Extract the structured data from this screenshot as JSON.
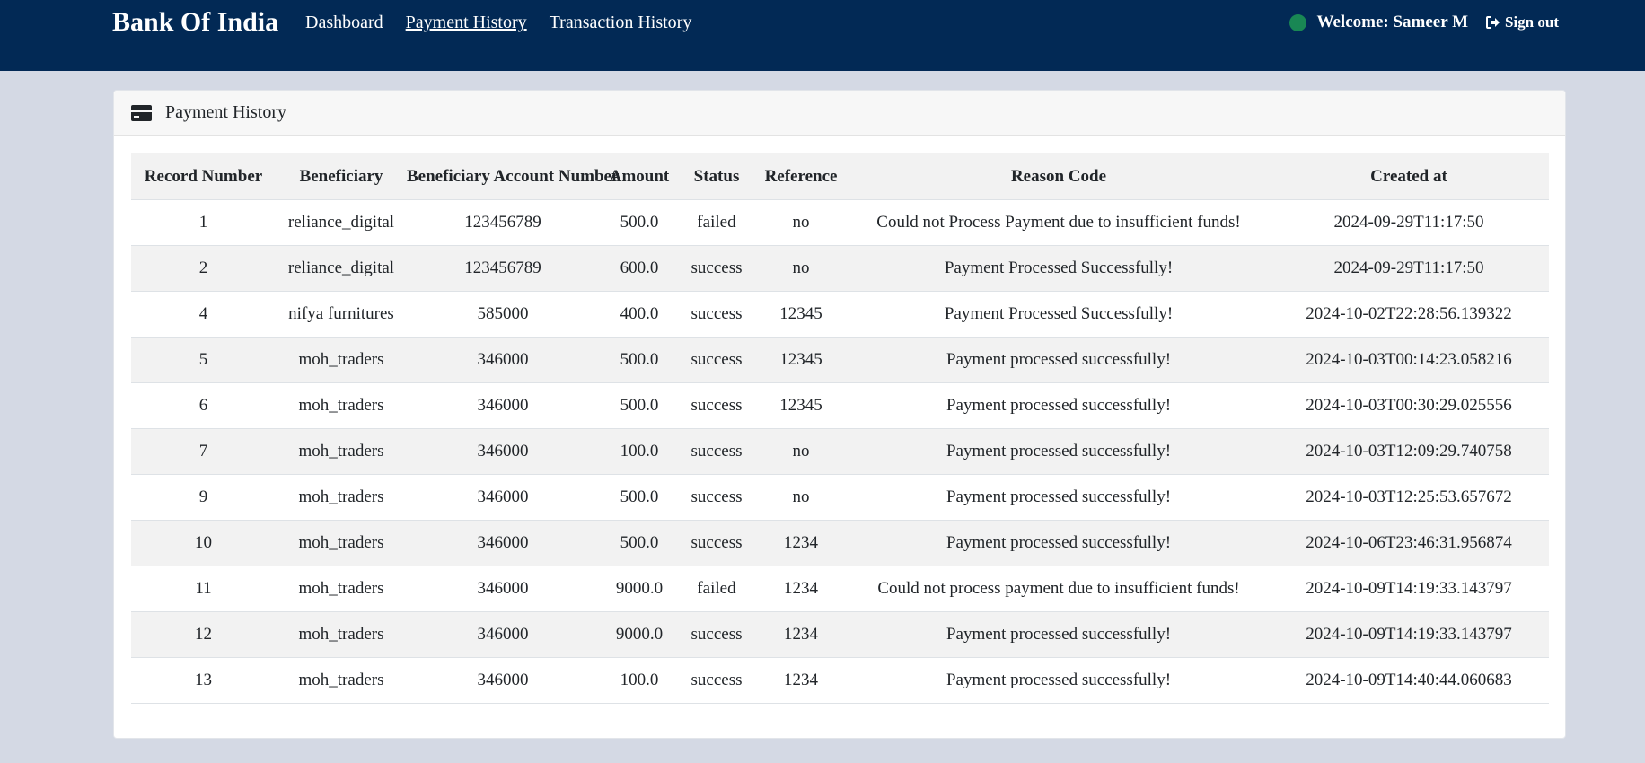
{
  "app": {
    "brand": "Bank Of India"
  },
  "nav": {
    "items": [
      {
        "label": "Dashboard",
        "active": false
      },
      {
        "label": "Payment History",
        "active": true
      },
      {
        "label": "Transaction History",
        "active": false
      }
    ],
    "welcome": "Welcome: Sameer M",
    "signout": "Sign out"
  },
  "colors": {
    "navbar": "#022955",
    "status_dot": "#198754",
    "page_bg": "#d4d9e4"
  },
  "icons": {
    "card_header": "credit-card-icon",
    "signout": "sign-out-icon",
    "status": "online-status-dot"
  },
  "card": {
    "title": "Payment History"
  },
  "table": {
    "headers": [
      "Record Number",
      "Beneficiary",
      "Beneficiary Account Number",
      "Amount",
      "Status",
      "Reference",
      "Reason Code",
      "Created at"
    ],
    "rows": [
      [
        "1",
        "reliance_digital",
        "123456789",
        "500.0",
        "failed",
        "no",
        "Could not Process Payment due to insufficient funds!",
        "2024-09-29T11:17:50"
      ],
      [
        "2",
        "reliance_digital",
        "123456789",
        "600.0",
        "success",
        "no",
        "Payment Processed Successfully!",
        "2024-09-29T11:17:50"
      ],
      [
        "4",
        "nifya furnitures",
        "585000",
        "400.0",
        "success",
        "12345",
        "Payment Processed Successfully!",
        "2024-10-02T22:28:56.139322"
      ],
      [
        "5",
        "moh_traders",
        "346000",
        "500.0",
        "success",
        "12345",
        "Payment processed successfully!",
        "2024-10-03T00:14:23.058216"
      ],
      [
        "6",
        "moh_traders",
        "346000",
        "500.0",
        "success",
        "12345",
        "Payment processed successfully!",
        "2024-10-03T00:30:29.025556"
      ],
      [
        "7",
        "moh_traders",
        "346000",
        "100.0",
        "success",
        "no",
        "Payment processed successfully!",
        "2024-10-03T12:09:29.740758"
      ],
      [
        "9",
        "moh_traders",
        "346000",
        "500.0",
        "success",
        "no",
        "Payment processed successfully!",
        "2024-10-03T12:25:53.657672"
      ],
      [
        "10",
        "moh_traders",
        "346000",
        "500.0",
        "success",
        "1234",
        "Payment processed successfully!",
        "2024-10-06T23:46:31.956874"
      ],
      [
        "11",
        "moh_traders",
        "346000",
        "9000.0",
        "failed",
        "1234",
        "Could not process payment due to insufficient funds!",
        "2024-10-09T14:19:33.143797"
      ],
      [
        "12",
        "moh_traders",
        "346000",
        "9000.0",
        "success",
        "1234",
        "Payment processed successfully!",
        "2024-10-09T14:19:33.143797"
      ],
      [
        "13",
        "moh_traders",
        "346000",
        "100.0",
        "success",
        "1234",
        "Payment processed successfully!",
        "2024-10-09T14:40:44.060683"
      ]
    ]
  }
}
